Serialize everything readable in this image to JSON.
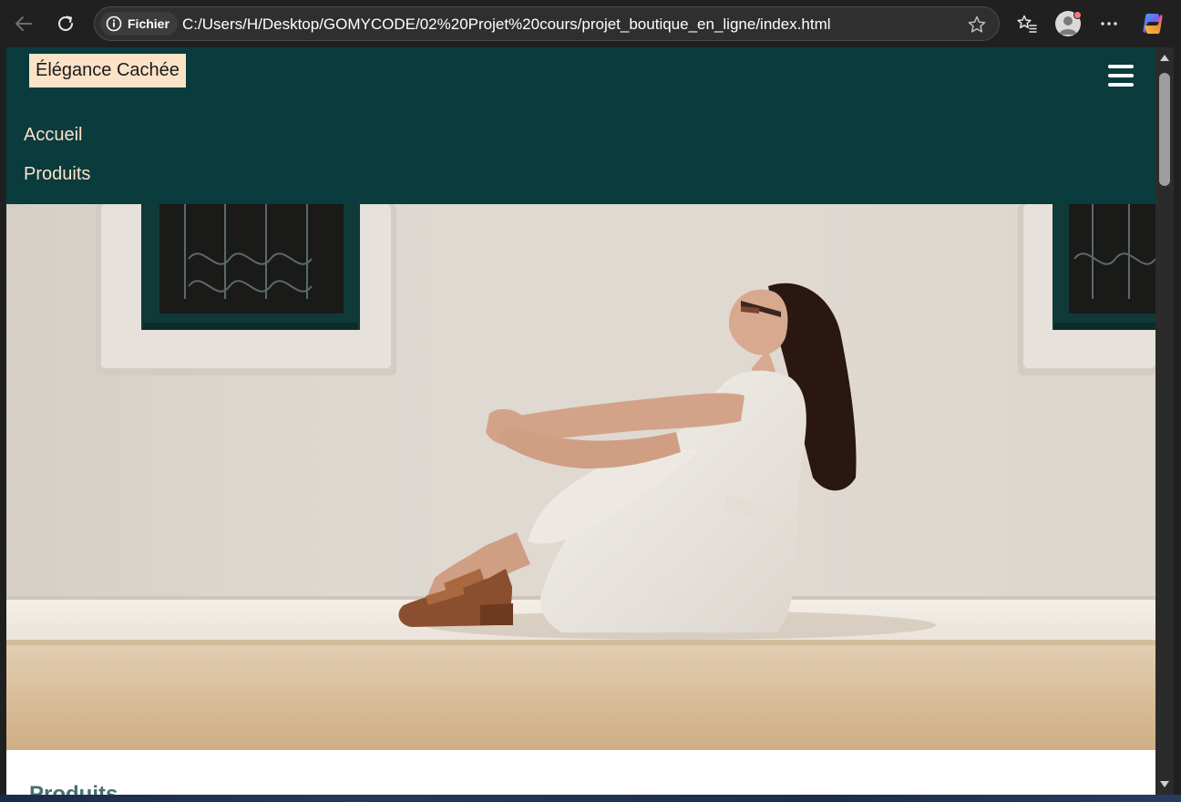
{
  "browser": {
    "site_info_label": "Fichier",
    "url": "C:/Users/H/Desktop/GOMYCODE/02%20Projet%20cours/projet_boutique_en_ligne/index.html",
    "icons": {
      "back": "back-arrow-icon",
      "reload": "reload-icon",
      "site_info": "info-icon",
      "favorite": "star-icon",
      "favorites": "favorites-icon",
      "profile": "profile-avatar-icon",
      "more": "more-icon",
      "copilot": "copilot-icon"
    }
  },
  "page": {
    "header": {
      "logo": "Élégance Cachée",
      "menu_icon": "hamburger-menu-icon",
      "nav": [
        {
          "label": "Accueil"
        },
        {
          "label": "Produits"
        }
      ]
    },
    "hero": {
      "image": "woman-in-white-dress-sitting-against-white-wall"
    },
    "section_title": "Produits"
  },
  "colors": {
    "header_bg": "#0a3b3d",
    "logo_bg": "#fce3c8",
    "nav_text": "#fce3c8",
    "chrome_bg": "#202020"
  }
}
